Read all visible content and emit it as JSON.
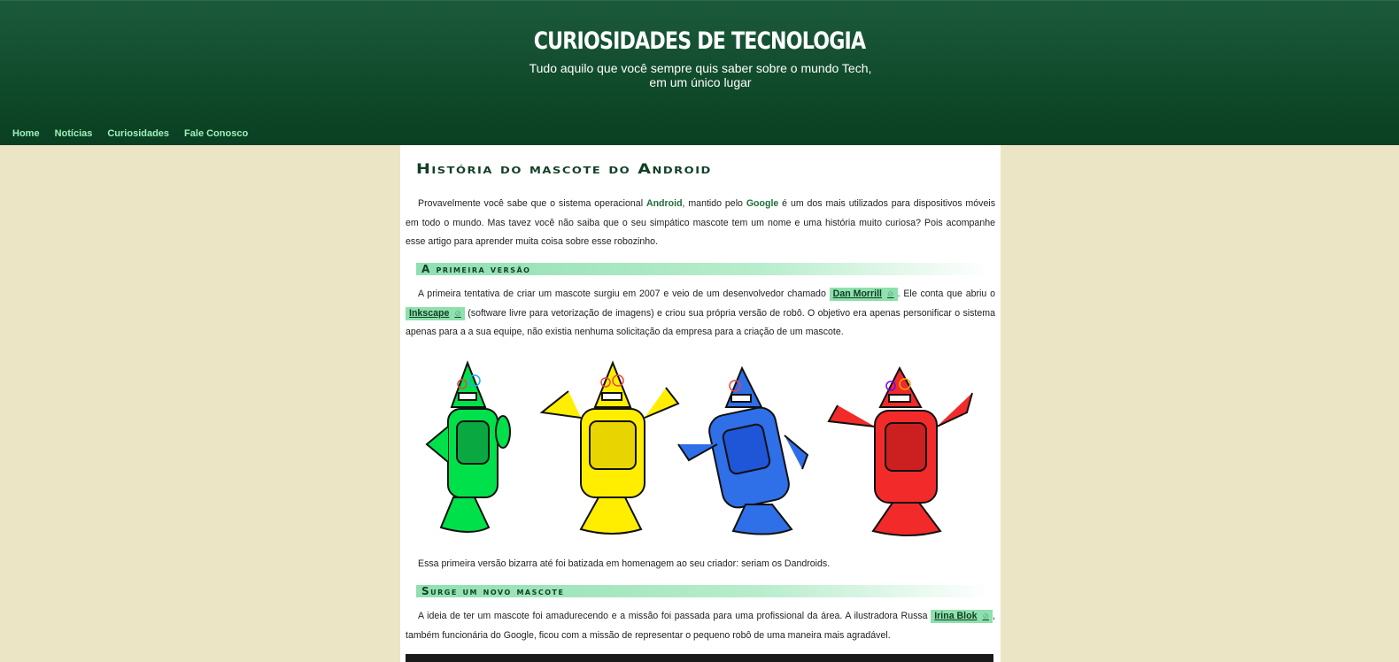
{
  "site": {
    "title": "Curiosidades de Tecnologia",
    "subtitle": "Tudo aquilo que você sempre quis saber sobre o mundo Tech, em um único lugar"
  },
  "nav": {
    "items": [
      {
        "label": "Home"
      },
      {
        "label": "Notícias"
      },
      {
        "label": "Curiosidades"
      },
      {
        "label": "Fale Conosco"
      }
    ]
  },
  "article": {
    "title": "História do mascote do Android",
    "intro": {
      "t1": "Provavelmente você sabe que o sistema operacional ",
      "android": "Android",
      "t2": ", mantido pelo ",
      "google": "Google",
      "t3": " é um dos mais utilizados para dispositivos móveis em todo o mundo. Mas tavez você não saiba que o seu simpático mascote tem um nome e uma história muito curiosa? Pois acompanhe esse artigo para aprender muita coisa sobre esse robozinho."
    },
    "section1": {
      "title": "A primeira versão",
      "p1a": "A primeira tentativa de criar um mascote surgiu em 2007 e veio de um desenvolvedor chamado ",
      "link1": "Dan Morrill",
      "p1b": ". Ele conta que abriu o ",
      "link2": "Inkscape",
      "p1c": " (software livre para vetorização de imagens) e criou sua própria versão de robô. O objetivo era apenas personificar o sistema apenas para a a sua equipe, não existia nenhuma solicitação da empresa para a criação de um mascote.",
      "p2": "Essa primeira versão bizarra até foi batizada em homenagem ao seu criador: seriam os Dandroids."
    },
    "section2": {
      "title": "Surge um novo mascote",
      "p1a": "A ideia de ter um mascote foi amadurecendo e a missão foi passada para uma profissional da área. A ilustradora Russa ",
      "link1": "Irina Blok",
      "p1b": ", também funcionária do Google, ficou com a missão de representar o pequeno robô de uma maneira mais agradável."
    },
    "external_link_icon": "external-link-icon",
    "colors": {
      "header": "#0f4a2a",
      "nav_link": "#9ef0b9",
      "link_chip": "#8ee0ac",
      "page_bg": "#ebe5c5",
      "robots": [
        "#00e04a",
        "#ffee00",
        "#2f6fe8",
        "#f22a2a"
      ]
    }
  }
}
